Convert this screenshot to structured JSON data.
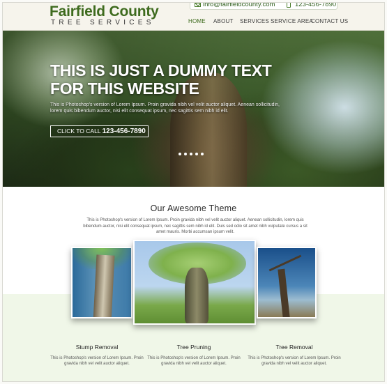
{
  "header": {
    "logo_main": "Fairfield County",
    "logo_sub": "TREE SERVICES",
    "email": "info@fairfieldcounty.com",
    "phone": "123-456-7890"
  },
  "nav": {
    "items": [
      "HOME",
      "ABOUT",
      "SERVICES",
      "SERVICE AREA",
      "CONTACT US"
    ],
    "active": "HOME"
  },
  "hero": {
    "title": "THIS IS JUST A DUMMY TEXT FOR THIS WEBSITE",
    "text": "This is Photoshop's version  of Lorem Ipsum. Proin gravida nibh vel velit auctor aliquet. Aenean sollicitudin, lorem quis bibendum auctor, nisi elit consequat ipsum, nec sagittis sem nibh id elit.",
    "cta_label": "CLICK TO CALL",
    "cta_phone": "123-456-7890",
    "slide_count": 5,
    "active_slide": 0
  },
  "theme": {
    "title": "Our Awesome Theme",
    "text": "This is Photoshop's version  of Lorem Ipsum. Proin gravida nibh vel velit auctor aliquet. Aenean sollicitudin, lorem quis bibendum auctor, nisi elit consequat ipsum, nec sagittis sem nibh id elit. Duis sed odio sit amet nibh vulputate cursus a sit amet mauris. Morbi accumsan ipsum velit."
  },
  "services": [
    {
      "title": "Stump Removal",
      "text": "This is Photoshop's version  of Lorem Ipsum. Proin gravida nibh vel velit auctor aliquet."
    },
    {
      "title": "Tree Pruning",
      "text": "This is Photoshop's version  of Lorem Ipsum. Proin gravida nibh vel velit auctor aliquet."
    },
    {
      "title": "Tree Removal",
      "text": "This is Photoshop's version  of Lorem Ipsum. Proin gravida nibh vel velit auctor aliquet."
    }
  ],
  "colors": {
    "brand_green": "#3e6b1e",
    "header_bg": "#f6f4ec",
    "band_bg": "#f0f7e8"
  }
}
